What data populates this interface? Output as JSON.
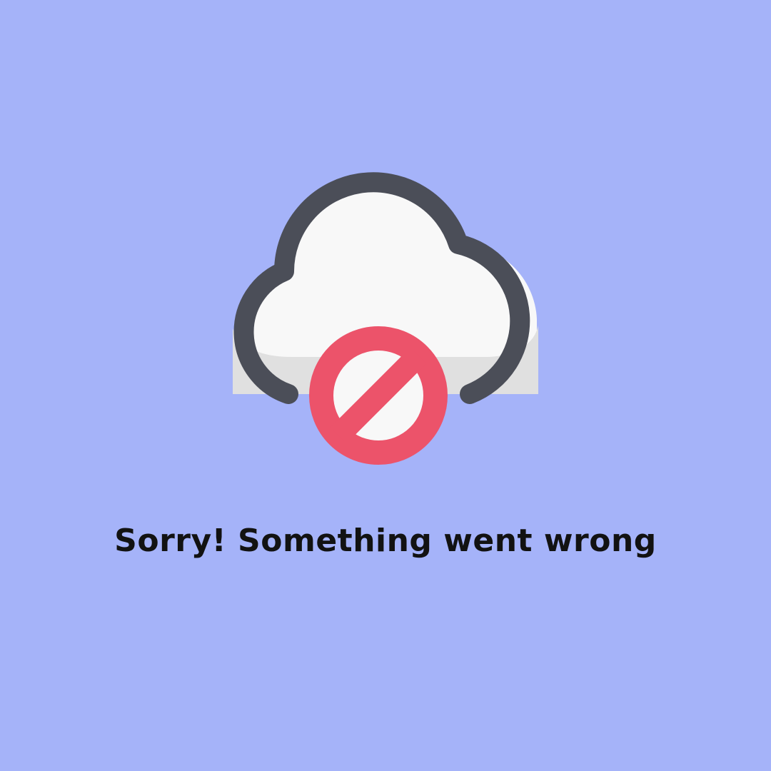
{
  "page": {
    "background_color": "#a5b3f9"
  },
  "illustration": {
    "cloud_icon": "cloud-icon",
    "prohibited_icon": "prohibited-icon",
    "cloud_fill_color": "#f8f8f8",
    "cloud_shade_color": "#e0e0e0",
    "cloud_outline_color": "#4b4e58",
    "prohibited_color": "#ec536a"
  },
  "error": {
    "message": "Sorry! Something went wrong"
  }
}
